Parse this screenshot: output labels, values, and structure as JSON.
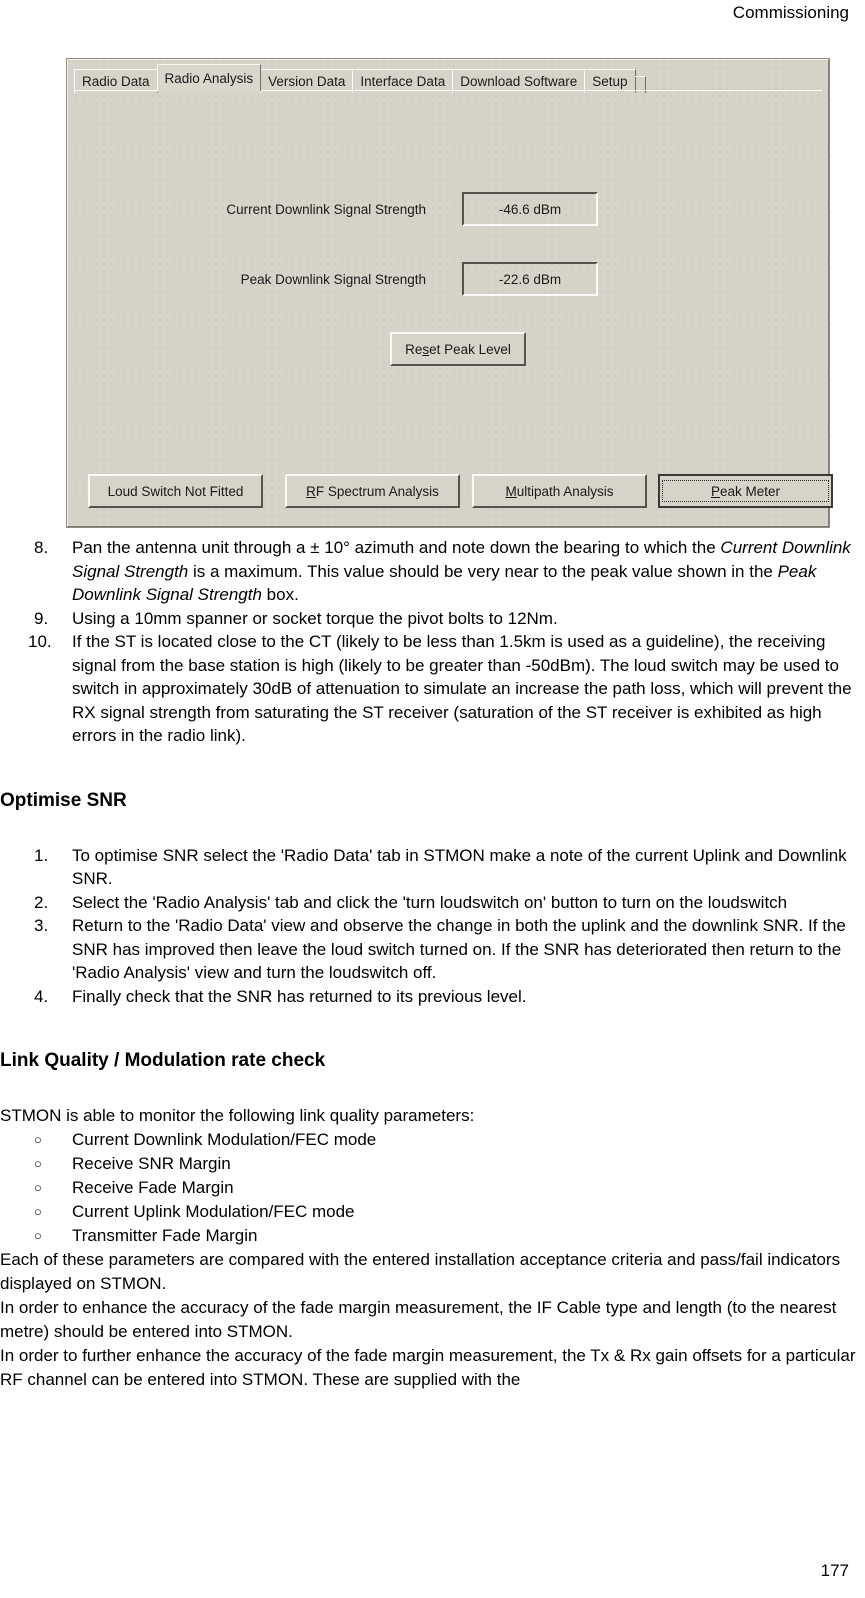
{
  "header": {
    "title": "Commissioning"
  },
  "page_number": "177",
  "screenshot": {
    "app_name": "STMON",
    "tabs": [
      {
        "label": "Radio Data",
        "selected": false
      },
      {
        "label": "Radio Analysis",
        "selected": true
      },
      {
        "label": "Version Data",
        "selected": false
      },
      {
        "label": "Interface Data",
        "selected": false
      },
      {
        "label": "Download Software",
        "selected": false
      },
      {
        "label": "Setup",
        "selected": false
      }
    ],
    "fields": [
      {
        "label": "Current Downlink Signal Strength",
        "value": "-46.6 dBm"
      },
      {
        "label": "Peak Downlink Signal Strength",
        "value": "-22.6 dBm"
      }
    ],
    "reset_button": {
      "pre": "Re",
      "accel": "s",
      "post": "et Peak Level"
    },
    "action_buttons": [
      {
        "pre": "Loud Switch Not Fitted",
        "accel": "",
        "post": "",
        "focused": false
      },
      {
        "pre": "",
        "accel": "R",
        "post": "F Spectrum Analysis",
        "focused": false
      },
      {
        "pre": "",
        "accel": "M",
        "post": "ultipath Analysis",
        "focused": false
      },
      {
        "pre": "",
        "accel": "P",
        "post": "eak Meter",
        "focused": true
      }
    ],
    "colors": {
      "dialog_face": "#d6d3c8",
      "highlight": "#fbfaf6",
      "shadow": "#54534d"
    }
  },
  "doc": {
    "steps_8_10": [
      {
        "number": "8.",
        "segments": [
          {
            "text": "Pan the antenna unit through a ± 10° azimuth and note down the bearing to which the ",
            "italic": false
          },
          {
            "text": "Current Downlink Signal Strength",
            "italic": true
          },
          {
            "text": " is a maximum. This value should be very near to the peak value shown in the ",
            "italic": false
          },
          {
            "text": "Peak Downlink Signal Strength",
            "italic": true
          },
          {
            "text": " box.",
            "italic": false
          }
        ]
      },
      {
        "number": "9.",
        "segments": [
          {
            "text": "Using a 10mm spanner or socket torque the pivot bolts to 12Nm.",
            "italic": false
          }
        ]
      },
      {
        "number": "10.",
        "segments": [
          {
            "text": "If the ST is located close to the CT (likely to be less than 1.5km is used as a guideline), the receiving signal from the base station is high (likely to be greater than -50dBm). The loud switch may be used to switch in approximately 30dB of attenuation to simulate an increase the path loss, which will prevent the RX signal strength from saturating the ST receiver (saturation of the ST receiver is exhibited as high errors in the radio link).",
            "italic": false
          }
        ]
      }
    ],
    "optimise_snr": {
      "heading": "Optimise SNR",
      "steps": [
        {
          "number": "1.",
          "text": "To optimise SNR select the 'Radio Data' tab in STMON make a note of the current Uplink and Downlink SNR."
        },
        {
          "number": "2.",
          "text": "Select the 'Radio Analysis'  tab and click the 'turn loudswitch on' button to turn on the loudswitch"
        },
        {
          "number": "3.",
          "text": "Return to the  'Radio Data'  view and observe the change in both the uplink and the downlink SNR. If the SNR has improved then leave the loud switch turned on. If the SNR has deteriorated then return to the 'Radio Analysis' view and turn the loudswitch off."
        },
        {
          "number": "4.",
          "text": "Finally check that the SNR has returned to its previous level."
        }
      ]
    },
    "link_quality": {
      "heading": "Link Quality / Modulation rate check",
      "intro": "STMON is able to monitor the following link quality parameters:",
      "bullet_marker": "○",
      "parameters": [
        "Current Downlink Modulation/FEC mode",
        "Receive SNR Margin",
        "Receive Fade Margin",
        "Current Uplink Modulation/FEC mode",
        "Transmitter Fade Margin"
      ],
      "paragraphs": [
        "Each of these parameters are compared with the entered installation acceptance criteria and pass/fail indicators displayed on STMON.",
        "In order to enhance the accuracy of the fade margin measurement, the IF Cable type and length (to the nearest metre) should be entered into STMON.",
        "In order to further enhance the accuracy of the fade margin measurement, the Tx & Rx gain offsets for a particular RF channel can be entered into STMON. These are supplied with the"
      ]
    }
  }
}
